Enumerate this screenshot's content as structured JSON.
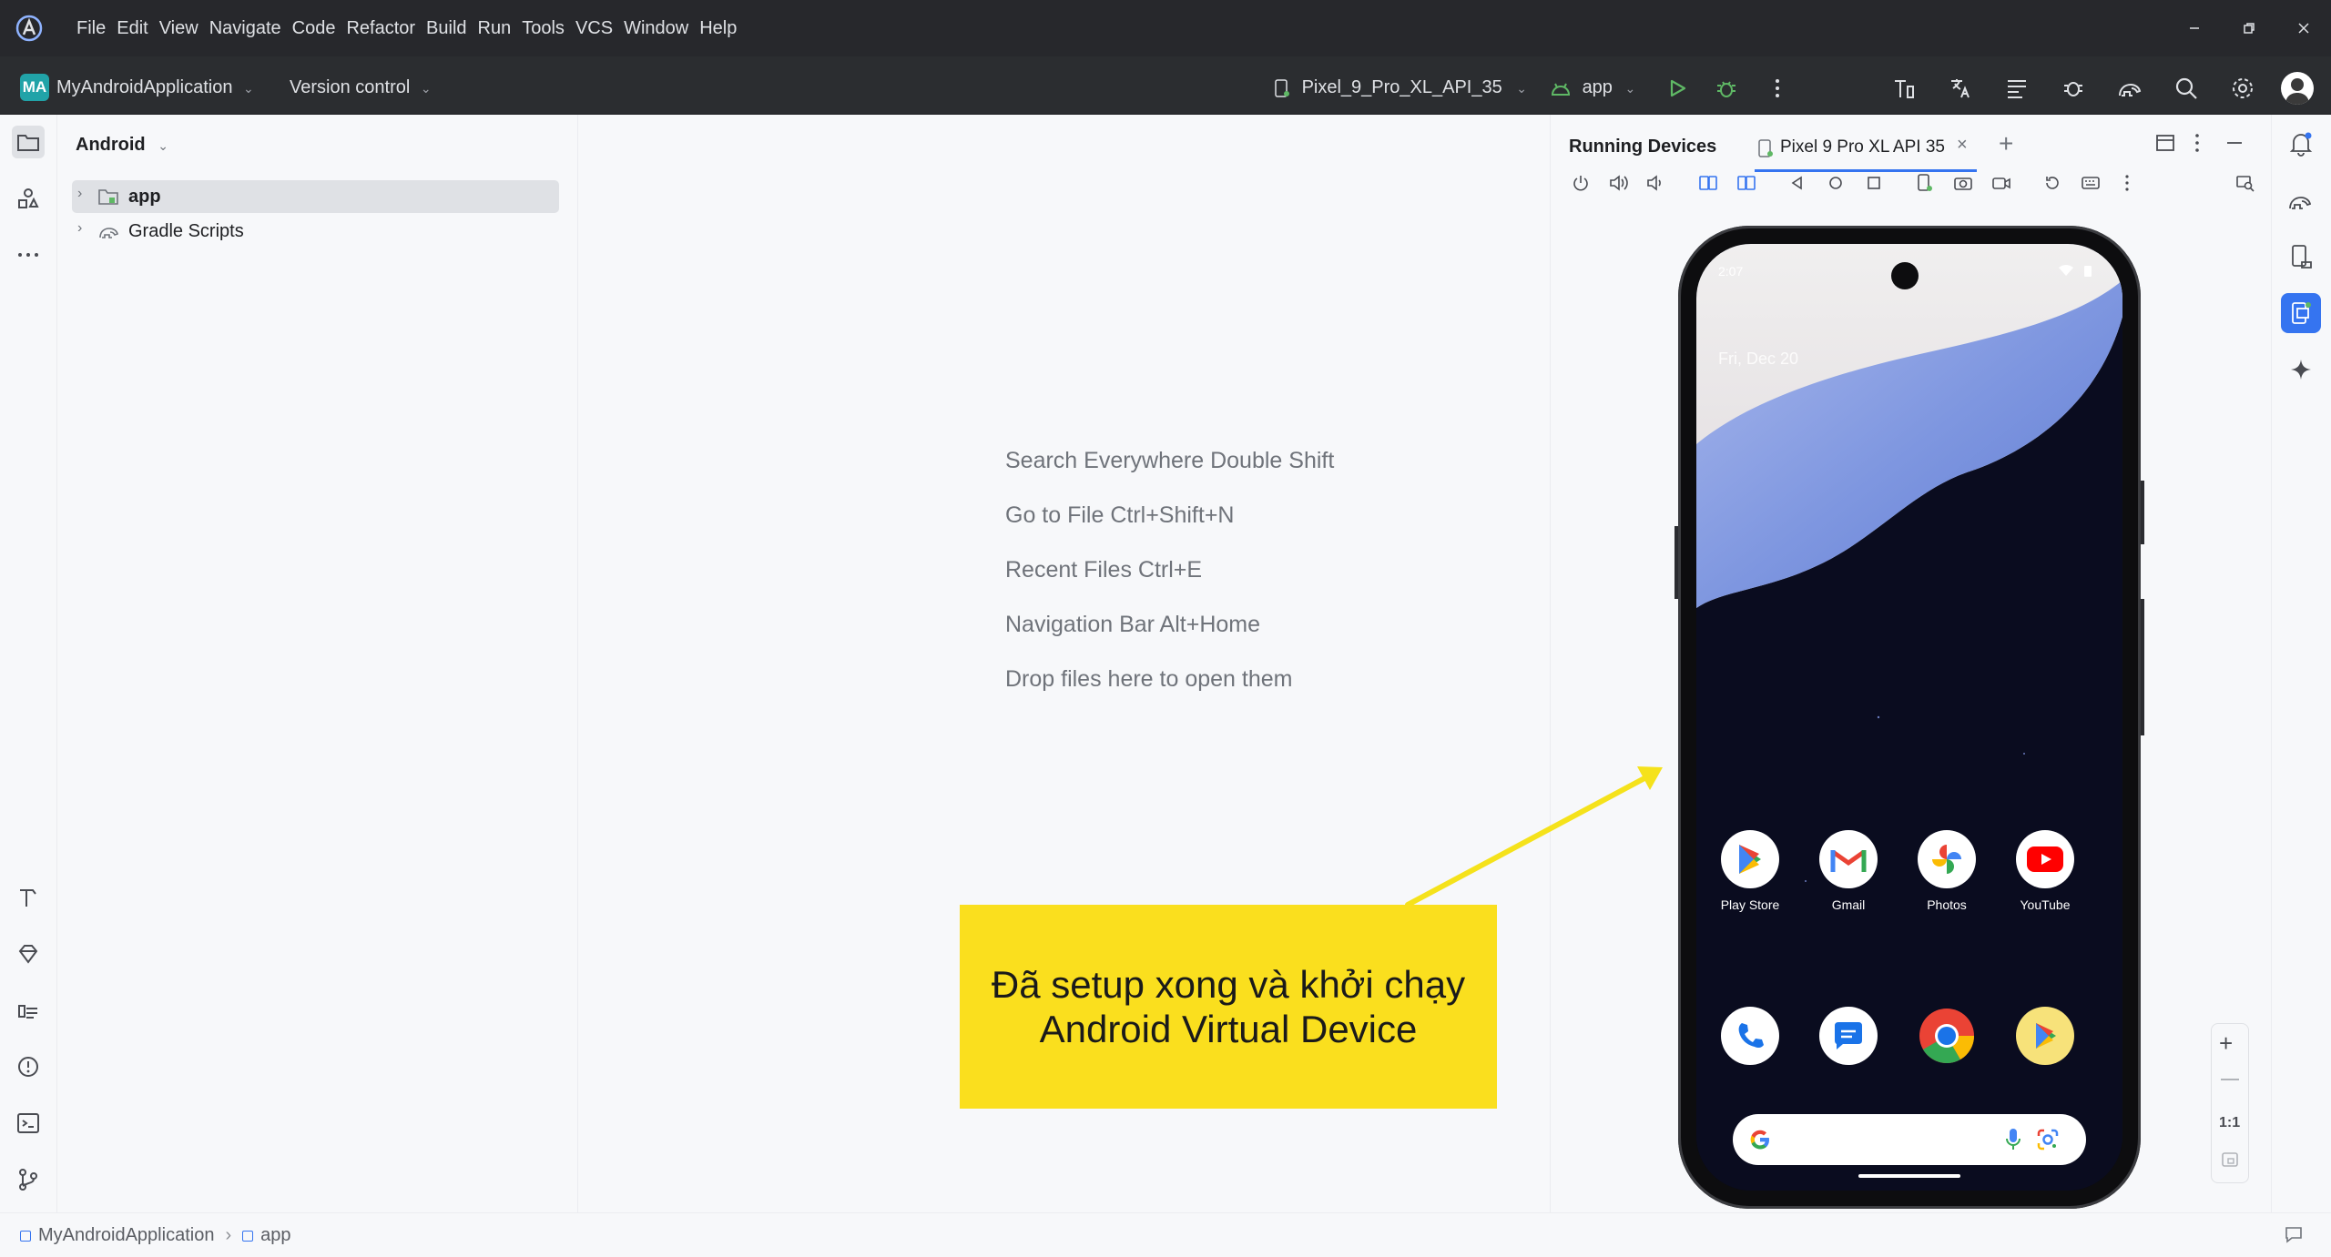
{
  "menu": [
    "File",
    "Edit",
    "View",
    "Navigate",
    "Code",
    "Refactor",
    "Build",
    "Run",
    "Tools",
    "VCS",
    "Window",
    "Help"
  ],
  "toolbar": {
    "project_badge": "MA",
    "project_name": "MyAndroidApplication",
    "version_control": "Version control",
    "device": "Pixel_9_Pro_XL_API_35",
    "run_config": "app"
  },
  "project_panel": {
    "title": "Android",
    "items": [
      {
        "label": "app",
        "selected": true
      },
      {
        "label": "Gradle Scripts",
        "selected": false
      }
    ]
  },
  "editor_hints": [
    "Search Everywhere Double Shift",
    "Go to File Ctrl+Shift+N",
    "Recent Files Ctrl+E",
    "Navigation Bar Alt+Home",
    "Drop files here to open them"
  ],
  "running_devices": {
    "title": "Running Devices",
    "tab": "Pixel 9 Pro XL API 35",
    "zoom_label": "1:1"
  },
  "phone": {
    "time": "2:07",
    "date": "Fri, Dec 20",
    "apps": [
      "Play Store",
      "Gmail",
      "Photos",
      "YouTube"
    ]
  },
  "callout": {
    "line1": "Đã setup xong và khởi chạy",
    "line2": "Android Virtual Device"
  },
  "statusbar": {
    "breadcrumb": [
      "MyAndroidApplication",
      "app"
    ]
  },
  "colors": {
    "titlebar": "#27282c",
    "toolbar": "#2b2d30",
    "accent": "#3574f0",
    "run_green": "#5fb865",
    "callout": "#fadf1e",
    "arrow": "#f5e21b"
  }
}
